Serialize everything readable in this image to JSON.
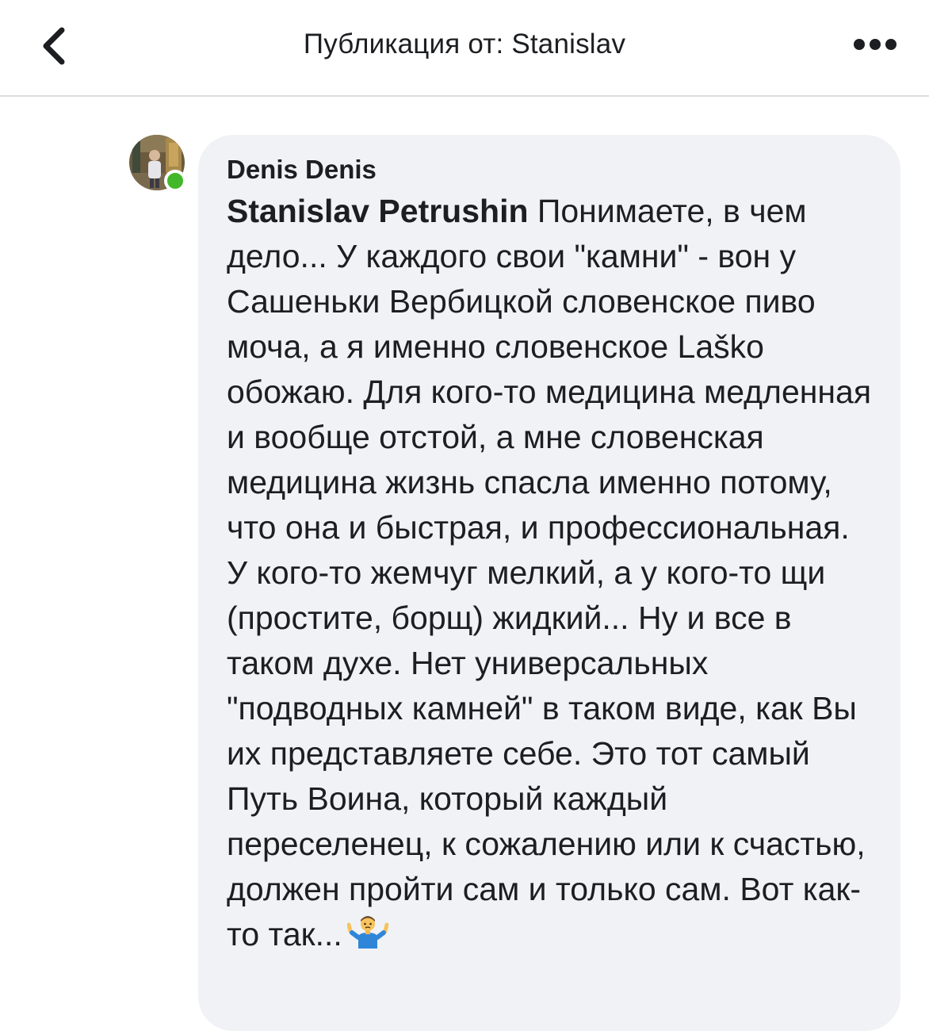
{
  "header": {
    "title": "Публикация от: Stanislav",
    "back_icon": "chevron-left-icon",
    "more_icon": "more-horizontal-icon"
  },
  "comment": {
    "author": "Denis Denis",
    "online": true,
    "mention": "Stanislav Petrushin",
    "text": " Понимаете, в чем дело... У каждого свои \"камни\" - вон у Сашеньки Вербицкой словенское пиво моча, а я именно словенское Laško обожаю. Для кого-то медицина медленная и вообще отстой, а мне словенская медицина жизнь спасла именно потому, что она и быстрая, и профессиональная.  У кого-то жемчуг мелкий, а у кого-то щи (простите, борщ) жидкий... Ну и все в таком духе. Нет универсальных \"подводных камней\" в таком виде, как Вы их представляете себе. Это тот самый Путь Воина, который каждый переселенец, к сожалению или к счастью, должен пройти сам и только  сам. Вот как-то так...",
    "emoji": "man-shrugging-emoji"
  },
  "colors": {
    "bubble": "#f0f2f5",
    "text": "#1c1e21",
    "online": "#42b72a",
    "divider": "#dcdde1"
  }
}
